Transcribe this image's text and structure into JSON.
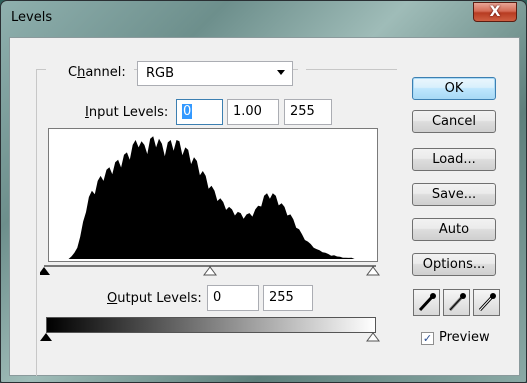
{
  "window": {
    "title": "Levels",
    "close_label": "X"
  },
  "channel": {
    "label_prefix": "C",
    "label_ul": "h",
    "label_suffix": "annel:",
    "value": "RGB"
  },
  "input_levels": {
    "label_prefix": "",
    "label_ul": "I",
    "label_suffix": "nput Levels:",
    "black": "0",
    "gamma": "1.00",
    "white": "255"
  },
  "output_levels": {
    "label_prefix": "",
    "label_ul": "O",
    "label_suffix": "utput Levels:",
    "black": "0",
    "white": "255"
  },
  "buttons": {
    "ok": "OK",
    "cancel": "Cancel",
    "load": "Load...",
    "save": "Save...",
    "auto": "Auto",
    "options": "Options..."
  },
  "preview": {
    "label": "Preview",
    "checked": true
  },
  "histogram_profile": [
    0,
    0,
    0,
    0,
    0,
    0,
    0,
    2,
    5,
    10,
    18,
    30,
    42,
    50,
    55,
    58,
    63,
    67,
    70,
    72,
    74,
    76,
    78,
    80,
    82,
    84,
    86,
    89,
    92,
    96,
    100,
    95,
    92,
    94,
    97,
    99,
    100,
    97,
    93,
    92,
    94,
    96,
    97,
    96,
    95,
    93,
    90,
    88,
    85,
    82,
    79,
    75,
    71,
    67,
    63,
    59,
    55,
    52,
    49,
    46,
    44,
    42,
    40,
    39,
    38,
    37,
    36,
    36,
    37,
    38,
    40,
    43,
    47,
    51,
    53,
    54,
    53,
    51,
    48,
    45,
    42,
    39,
    36,
    32,
    28,
    24,
    20,
    17,
    14,
    12,
    10,
    8,
    7,
    6,
    5,
    4,
    3,
    3,
    2,
    2,
    1,
    1,
    1,
    1,
    0,
    0,
    0,
    0,
    0,
    0,
    0,
    0
  ],
  "colors": {
    "histogram": "#000000",
    "highlight": "#3399ff",
    "dialog_bg": "#f0f0f0"
  }
}
